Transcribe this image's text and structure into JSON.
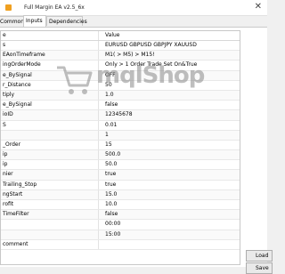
{
  "window": {
    "title": "Full Margin EA v2.5_6x",
    "close_glyph": "✕"
  },
  "tabs": [
    {
      "label": "Common",
      "active": false
    },
    {
      "label": "Inputs",
      "active": true
    },
    {
      "label": "Dependencies",
      "active": false
    }
  ],
  "table": {
    "headers": {
      "variable": "e",
      "value": "Value"
    },
    "rows": [
      {
        "variable": "s",
        "value": "EURUSD GBPUSD GBPJPY XAUUSD"
      },
      {
        "variable": "EAonTimeframe",
        "value": "M1( > M5) > M15!"
      },
      {
        "variable": "ingOrderMode",
        "value": "Only > 1 Order Trade Set On&True"
      },
      {
        "variable": "e_BySignal",
        "value": "OFF"
      },
      {
        "variable": "r_Distance",
        "value": "50"
      },
      {
        "variable": "tiply",
        "value": "1.0"
      },
      {
        "variable": "e_BySignal",
        "value": "false"
      },
      {
        "variable": "ioID",
        "value": "12345678"
      },
      {
        "variable": "S",
        "value": "0.01"
      },
      {
        "variable": "",
        "value": "1"
      },
      {
        "variable": "_Order",
        "value": "15"
      },
      {
        "variable": "ip",
        "value": "500.0"
      },
      {
        "variable": "ip",
        "value": "50.0"
      },
      {
        "variable": "nier",
        "value": "true"
      },
      {
        "variable": "Trailing_Stop",
        "value": "true"
      },
      {
        "variable": "ngStart",
        "value": "15.0"
      },
      {
        "variable": "rofit",
        "value": "10.0"
      },
      {
        "variable": "TimeFilter",
        "value": "false"
      },
      {
        "variable": "",
        "value": "00:00"
      },
      {
        "variable": "",
        "value": "15:00"
      },
      {
        "variable": "comment",
        "value": ""
      }
    ]
  },
  "buttons": {
    "load": "Load",
    "save": "Save"
  },
  "watermark": {
    "text": "mqlShop"
  },
  "colors": {
    "window_bg": "#f0f0f0",
    "table_bg": "#ffffff",
    "watermark": "#8a8a8a",
    "title_icon": "#f0a020"
  }
}
